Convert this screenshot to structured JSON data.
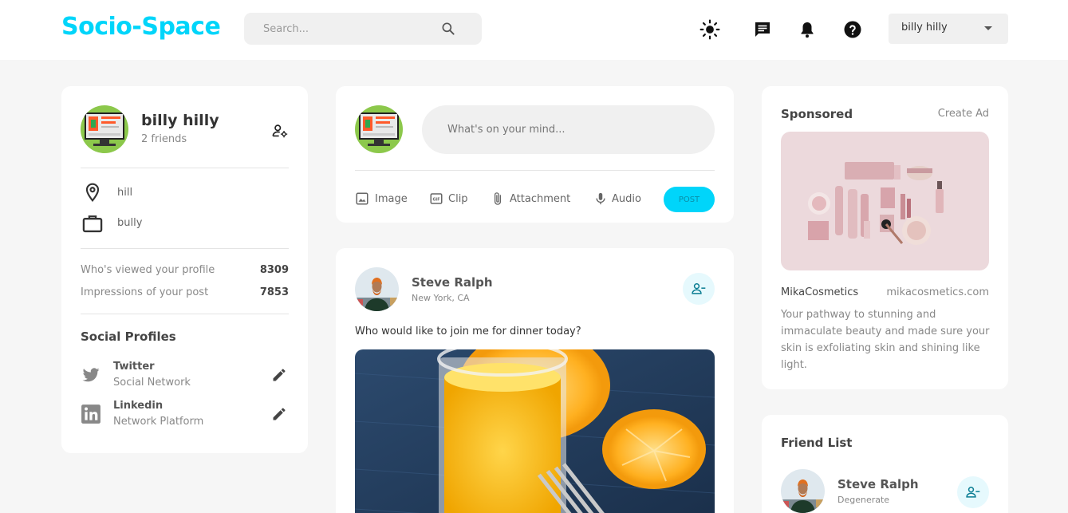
{
  "navbar": {
    "logo": "Socio-Space",
    "search_placeholder": "Search...",
    "user_select": "billy hilly"
  },
  "profile": {
    "name": "billy hilly",
    "friends": "2 friends",
    "location": "hill",
    "occupation": "bully",
    "stats": [
      {
        "label": "Who's viewed your profile",
        "value": "8309"
      },
      {
        "label": "Impressions of your post",
        "value": "7853"
      }
    ],
    "social_title": "Social Profiles",
    "socials": [
      {
        "name": "Twitter",
        "sub": "Social Network",
        "icon": "twitter-icon"
      },
      {
        "name": "Linkedin",
        "sub": "Network Platform",
        "icon": "linkedin-icon"
      }
    ]
  },
  "composer": {
    "placeholder": "What's on your mind...",
    "actions": [
      "Image",
      "Clip",
      "Attachment",
      "Audio"
    ],
    "post_label": "POST"
  },
  "post": {
    "author": "Steve Ralph",
    "location": "New York, CA",
    "text": "Who would like to join me for dinner today?"
  },
  "sponsored": {
    "title": "Sponsored",
    "create_ad": "Create Ad",
    "brand": "MikaCosmetics",
    "url": "mikacosmetics.com",
    "description": "Your pathway to stunning and immaculate beauty and made sure your skin is exfoliating skin and shining like light."
  },
  "friend_list": {
    "title": "Friend List",
    "friends": [
      {
        "name": "Steve Ralph",
        "sub": "Degenerate"
      }
    ]
  },
  "colors": {
    "accent": "#00d5fa",
    "background": "#f6f6f6",
    "card": "#ffffff"
  }
}
